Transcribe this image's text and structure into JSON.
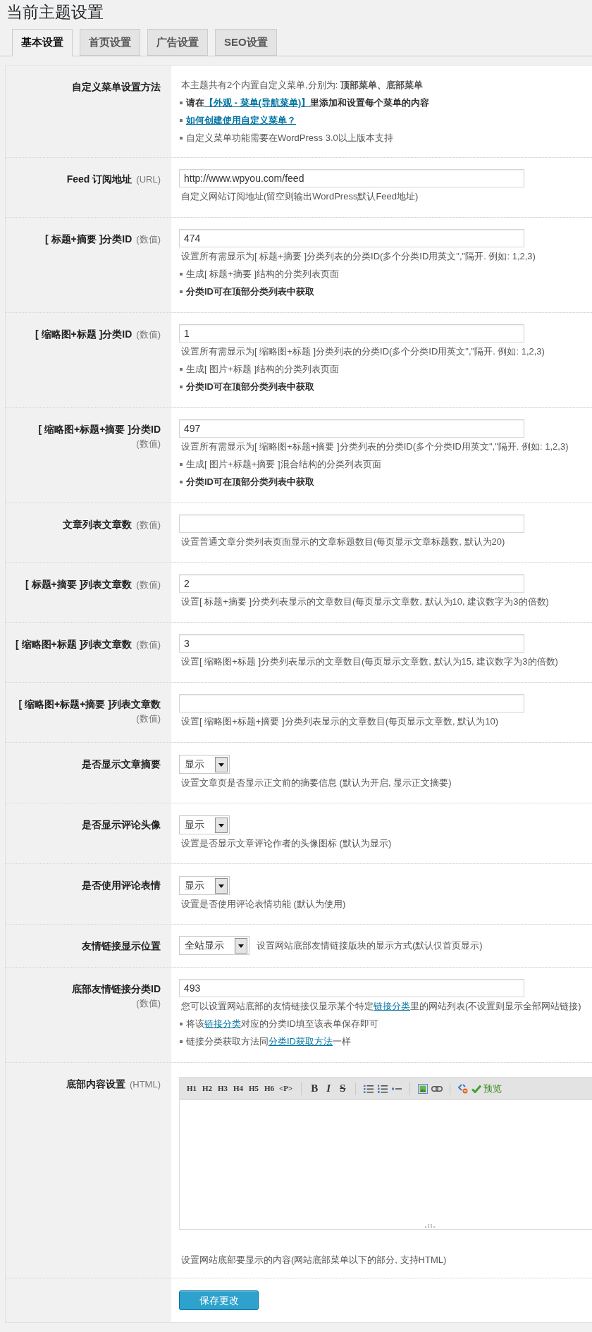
{
  "page_title": "当前主题设置",
  "tabs": [
    {
      "label": "基本设置",
      "selected": true
    },
    {
      "label": "首页设置",
      "selected": false
    },
    {
      "label": "广告设置",
      "selected": false
    },
    {
      "label": "SEO设置",
      "selected": false
    }
  ],
  "settings": [
    {
      "kind": "info",
      "label": "自定义菜单设置方法",
      "lines": [
        {
          "bullet": false,
          "bold": false,
          "parts": [
            {
              "kind": "text",
              "text": "本主题共有2个内置自定义菜单,分别为: **顶部菜单、底部菜单**"
            }
          ]
        },
        {
          "bullet": true,
          "bold": true,
          "parts": [
            {
              "kind": "text",
              "text": "请在"
            },
            {
              "kind": "link",
              "text": "【外观 - 菜单(导航菜单)】"
            },
            {
              "kind": "text",
              "text": "里添加和设置每个菜单的内容"
            }
          ]
        },
        {
          "bullet": true,
          "bold": true,
          "parts": [
            {
              "kind": "link",
              "text": "如何创建使用自定义菜单？"
            }
          ]
        },
        {
          "bullet": true,
          "bold": false,
          "parts": [
            {
              "kind": "text",
              "text": "自定义菜单功能需要在WordPress 3.0以上版本支持"
            }
          ]
        }
      ]
    },
    {
      "kind": "text",
      "label": "Feed 订阅地址",
      "hint": "(URL)",
      "value": "http://www.wpyou.com/feed",
      "lines": [
        {
          "bullet": false,
          "bold": false,
          "parts": [
            {
              "kind": "text",
              "text": "自定义网站订阅地址(留空则输出WordPress默认Feed地址)"
            }
          ]
        }
      ]
    },
    {
      "kind": "text",
      "label": "[ 标题+摘要 ]分类ID",
      "hint": "(数值)",
      "value": "474",
      "lines": [
        {
          "bullet": false,
          "bold": false,
          "parts": [
            {
              "kind": "text",
              "text": "设置所有需显示为[ 标题+摘要 ]分类列表的分类ID(多个分类ID用英文\",\"隔开. 例如: 1,2,3)"
            }
          ]
        },
        {
          "bullet": true,
          "bold": false,
          "parts": [
            {
              "kind": "text",
              "text": "生成[ 标题+摘要 ]结构的分类列表页面"
            }
          ]
        },
        {
          "bullet": true,
          "bold": true,
          "parts": [
            {
              "kind": "text",
              "text": "分类ID可在顶部分类列表中获取"
            }
          ]
        }
      ]
    },
    {
      "kind": "text",
      "label": "[ 缩略图+标题 ]分类ID",
      "hint": "(数值)",
      "value": "1",
      "lines": [
        {
          "bullet": false,
          "bold": false,
          "parts": [
            {
              "kind": "text",
              "text": "设置所有需显示为[ 缩略图+标题 ]分类列表的分类ID(多个分类ID用英文\",\"隔开. 例如: 1,2,3)"
            }
          ]
        },
        {
          "bullet": true,
          "bold": false,
          "parts": [
            {
              "kind": "text",
              "text": "生成[ 图片+标题 ]结构的分类列表页面"
            }
          ]
        },
        {
          "bullet": true,
          "bold": true,
          "parts": [
            {
              "kind": "text",
              "text": "分类ID可在顶部分类列表中获取"
            }
          ]
        }
      ]
    },
    {
      "kind": "text",
      "label": "[ 缩略图+标题+摘要 ]分类ID",
      "hint": "(数值)",
      "hint_below": true,
      "value": "497",
      "lines": [
        {
          "bullet": false,
          "bold": false,
          "parts": [
            {
              "kind": "text",
              "text": "设置所有需显示为[ 缩略图+标题+摘要 ]分类列表的分类ID(多个分类ID用英文\",\"隔开. 例如: 1,2,3)"
            }
          ]
        },
        {
          "bullet": true,
          "bold": false,
          "parts": [
            {
              "kind": "text",
              "text": "生成[ 图片+标题+摘要 ]混合结构的分类列表页面"
            }
          ]
        },
        {
          "bullet": true,
          "bold": true,
          "parts": [
            {
              "kind": "text",
              "text": "分类ID可在顶部分类列表中获取"
            }
          ]
        }
      ]
    },
    {
      "kind": "text",
      "label": "文章列表文章数",
      "hint": "(数值)",
      "lines": [
        {
          "bullet": false,
          "bold": false,
          "parts": [
            {
              "kind": "text",
              "text": "设置普通文章分类列表页面显示的文章标题数目(每页显示文章标题数, 默认为20)"
            }
          ]
        }
      ]
    },
    {
      "kind": "text",
      "label": "[ 标题+摘要 ]列表文章数",
      "hint": "(数值)",
      "value": "2",
      "lines": [
        {
          "bullet": false,
          "bold": false,
          "parts": [
            {
              "kind": "text",
              "text": "设置[ 标题+摘要 ]分类列表显示的文章数目(每页显示文章数, 默认为10, 建议数字为3的倍数)"
            }
          ]
        }
      ]
    },
    {
      "kind": "text",
      "label": "[ 缩略图+标题 ]列表文章数",
      "hint": "(数值)",
      "value": "3",
      "lines": [
        {
          "bullet": false,
          "bold": false,
          "parts": [
            {
              "kind": "text",
              "text": "设置[ 缩略图+标题 ]分类列表显示的文章数目(每页显示文章数, 默认为15, 建议数字为3的倍数)"
            }
          ]
        }
      ]
    },
    {
      "kind": "text",
      "label": "[ 缩略图+标题+摘要 ]列表文章数",
      "hint": "(数值)",
      "hint_below": true,
      "lines": [
        {
          "bullet": false,
          "bold": false,
          "parts": [
            {
              "kind": "text",
              "text": "设置[ 缩略图+标题+摘要 ]分类列表显示的文章数目(每页显示文章数, 默认为10)"
            }
          ]
        }
      ]
    },
    {
      "kind": "select",
      "label": "是否显示文章摘要",
      "value": "显示",
      "lines": [
        {
          "bullet": false,
          "bold": false,
          "parts": [
            {
              "kind": "text",
              "text": "设置文章页是否显示正文前的摘要信息 (默认为开启, 显示正文摘要)"
            }
          ]
        }
      ]
    },
    {
      "kind": "select",
      "label": "是否显示评论头像",
      "value": "显示",
      "lines": [
        {
          "bullet": false,
          "bold": false,
          "parts": [
            {
              "kind": "text",
              "text": "设置是否显示文章评论作者的头像图标 (默认为显示)"
            }
          ]
        }
      ]
    },
    {
      "kind": "select",
      "label": "是否使用评论表情",
      "value": "显示",
      "lines": [
        {
          "bullet": false,
          "bold": false,
          "parts": [
            {
              "kind": "text",
              "text": "设置是否使用评论表情功能 (默认为使用)"
            }
          ]
        }
      ]
    },
    {
      "kind": "select_inline",
      "label": "友情链接显示位置",
      "value": "全站显示",
      "lines": [
        {
          "bullet": false,
          "bold": false,
          "parts": [
            {
              "kind": "text",
              "text": "设置网站底部友情链接版块的显示方式(默认仅首页显示)"
            }
          ]
        }
      ]
    },
    {
      "kind": "text",
      "label": "底部友情链接分类ID",
      "hint": "(数值)",
      "hint_below": true,
      "value": "493",
      "lines": [
        {
          "bullet": false,
          "bold": false,
          "parts": [
            {
              "kind": "text",
              "text": "您可以设置网站底部的友情链接仅显示某个特定"
            },
            {
              "kind": "link",
              "text": "链接分类"
            },
            {
              "kind": "text",
              "text": "里的网站列表(不设置则显示全部网站链接)"
            }
          ]
        },
        {
          "bullet": true,
          "bold": false,
          "parts": [
            {
              "kind": "text",
              "text": "将该"
            },
            {
              "kind": "link",
              "text": "链接分类"
            },
            {
              "kind": "text",
              "text": "对应的分类ID填至该表单保存即可"
            }
          ]
        },
        {
          "bullet": true,
          "bold": false,
          "parts": [
            {
              "kind": "text",
              "text": "链接分类获取方法同"
            },
            {
              "kind": "link",
              "text": "分类ID获取方法"
            },
            {
              "kind": "text",
              "text": "一样"
            }
          ]
        }
      ]
    },
    {
      "kind": "editor",
      "label": "底部内容设置",
      "hint": "(HTML)",
      "toolbar": {
        "headings": [
          "H1",
          "H2",
          "H3",
          "H4",
          "H5",
          "H6",
          "<P>"
        ],
        "formats": [
          {
            "kind": "bold",
            "label": "B"
          },
          {
            "kind": "italic",
            "label": "I"
          },
          {
            "kind": "strike",
            "label": "S"
          }
        ],
        "preview": "预览"
      },
      "lines": [
        {
          "bullet": false,
          "bold": false,
          "parts": [
            {
              "kind": "text",
              "text": "设置网站底部要显示的内容(网站底部菜单以下的部分, 支持HTML)"
            }
          ]
        }
      ]
    },
    {
      "kind": "submit",
      "button": "保存更改"
    }
  ]
}
